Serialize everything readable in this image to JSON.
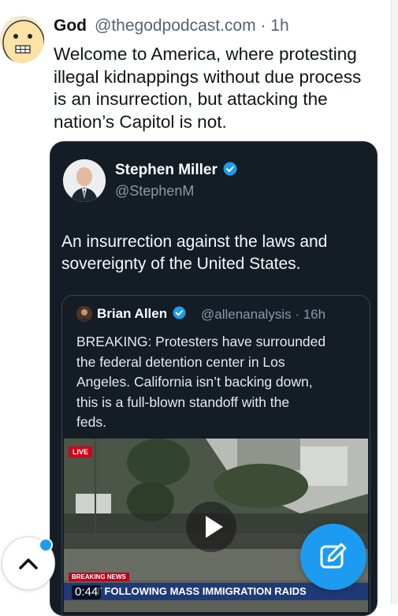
{
  "post": {
    "author_name": "God",
    "author_handle": "@thegodpodcast.com · 1h",
    "text_lines": [
      "Welcome to America, where protesting",
      "illegal kidnappings without due process",
      "is an insurrection, but attacking the",
      "nation’s Capitol is not."
    ]
  },
  "quoted_post": {
    "author_name": "Stephen Miller",
    "author_handle": "@StephenM",
    "verified_badge_color": "#1d9bf0",
    "text_lines": [
      "An insurrection against the laws and",
      "sovereignty of the United States."
    ],
    "nested_quote": {
      "author_name": "Brian Allen",
      "author_handle": "@allenanalysis · 16h",
      "text_lines": [
        "BREAKING: Protesters have surrounded",
        "the federal detention center in Los",
        "Angeles. California isn’t backing down,",
        "this is a full-blown standoff with the",
        "feds."
      ],
      "video": {
        "live_label": "LIVE",
        "breaking_label": "BREAKING NEWS",
        "ticker_text": "T FOLLOWING MASS IMMIGRATION RAIDS",
        "duration": "0:44"
      }
    }
  },
  "controls": {
    "scroll_top_icon": "chevron-up-icon",
    "compose_icon": "compose-icon",
    "accent_color": "#1d9bf0"
  }
}
